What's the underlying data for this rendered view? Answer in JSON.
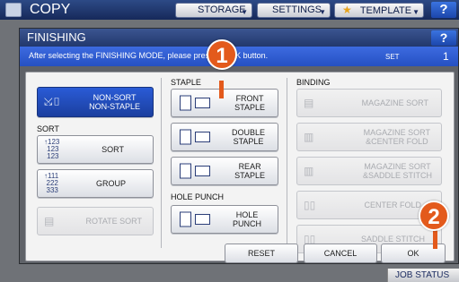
{
  "background": {
    "title": "COPY",
    "tabs": [
      {
        "label": "STORAGE"
      },
      {
        "label": "SETTINGS"
      },
      {
        "label": "TEMPLATE"
      }
    ],
    "help": "?",
    "job_status": "JOB STATUS"
  },
  "dialog": {
    "title": "FINISHING",
    "help": "?",
    "message": "After selecting the FINISHING MODE, please press the OK button.",
    "set_label": "SET",
    "set_count": "1"
  },
  "left": {
    "non_sort_line1": "NON-SORT",
    "non_sort_line2": "NON-STAPLE",
    "sort_section": "SORT",
    "sort": "SORT",
    "group": "GROUP",
    "rotate_sort": "ROTATE SORT"
  },
  "staple": {
    "section": "STAPLE",
    "front_line1": "FRONT",
    "front_line2": "STAPLE",
    "double_line1": "DOUBLE",
    "double_line2": "STAPLE",
    "rear_line1": "REAR",
    "rear_line2": "STAPLE",
    "hole_section": "HOLE PUNCH",
    "hole_line1": "HOLE",
    "hole_line2": "PUNCH"
  },
  "binding": {
    "section": "BINDING",
    "magazine_sort": "MAGAZINE SORT",
    "mag_center_line1": "MAGAZINE SORT",
    "mag_center_line2": "&CENTER FOLD",
    "mag_saddle_line1": "MAGAZINE SORT",
    "mag_saddle_line2": "&SADDLE STITCH",
    "center_fold": "CENTER FOLD",
    "saddle_stitch": "SADDLE STITCH"
  },
  "footer": {
    "reset": "RESET",
    "cancel": "CANCEL",
    "ok": "OK"
  },
  "callouts": [
    "1",
    "2"
  ],
  "colors": {
    "accent": "#2a5bd6",
    "header": "#22386c",
    "callout": "#e35a1c"
  }
}
